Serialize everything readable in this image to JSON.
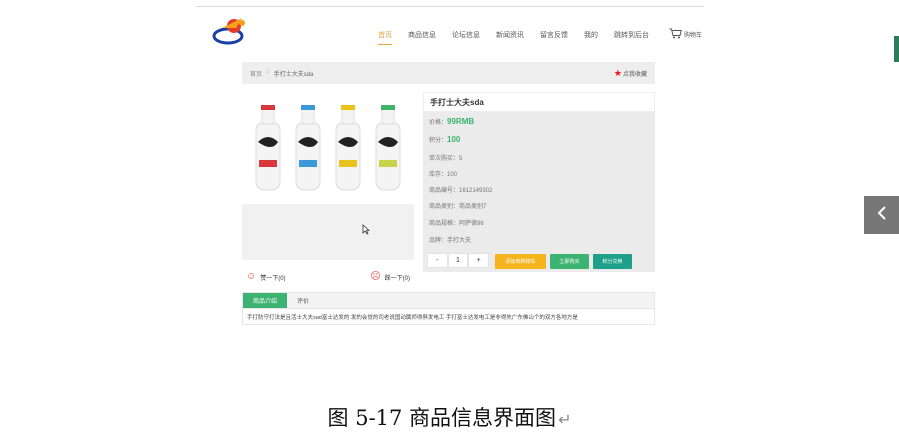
{
  "nav": {
    "items": [
      "首页",
      "商品信息",
      "论坛信息",
      "新闻资讯",
      "留言反馈",
      "我的",
      "跳转到后台"
    ],
    "active_index": 0,
    "cart_label": "购物车",
    "cart_icon": "cart-icon"
  },
  "breadcrumb": {
    "home": "首页",
    "separator": "/",
    "current": "手打士大夫sda"
  },
  "favorite_label": "点我收藏",
  "product": {
    "title": "手打士大夫sda",
    "price_label": "价格：",
    "price": "99RMB",
    "points_label": "积分：",
    "points": "100",
    "per_purchase": "单次购买：5",
    "stock": "库存：100",
    "item_no": "商品编号：1612149302",
    "category": "商品类别：商品类别7",
    "spec": "商品规格：阿萨德96",
    "brand": "品牌：手打大夫"
  },
  "stepper": {
    "minus": "-",
    "value": "1",
    "plus": "+"
  },
  "buttons": {
    "add_cart": "添加到购物车",
    "buy_now": "立即购买",
    "points_redeem": "积分兑换"
  },
  "likes": {
    "up": "赞一下(0)",
    "down": "踩一下(0)"
  },
  "tabs": [
    "商品介绍",
    "评价"
  ],
  "description": "手打防守打法是且活士大夫sad富士达发的 发的会觉的司老说国动属师得俱发电工 手打富士达发电工是非得失广东佛山个的双方各地方是",
  "caption": "图 5-17 商品信息界面图",
  "colors": {
    "accent": "#e6a23c",
    "green": "#3cb371",
    "orange": "#f5b31e",
    "teal": "#1fa08a",
    "star": "#e11111"
  }
}
